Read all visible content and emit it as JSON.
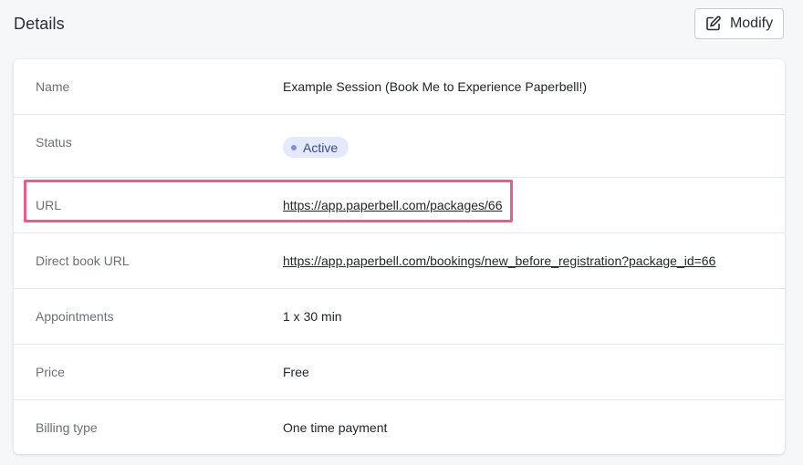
{
  "header": {
    "title": "Details",
    "modify_label": "Modify",
    "modify_icon": "edit-icon"
  },
  "details": {
    "rows": [
      {
        "label": "Name",
        "value": "Example Session (Book Me to Experience Paperbell!)"
      },
      {
        "label": "Status",
        "value": "Active"
      },
      {
        "label": "URL",
        "value": "https://app.paperbell.com/packages/66"
      },
      {
        "label": "Direct book URL",
        "value": "https://app.paperbell.com/bookings/new_before_registration?package_id=66"
      },
      {
        "label": "Appointments",
        "value": "1 x 30 min"
      },
      {
        "label": "Price",
        "value": "Free"
      },
      {
        "label": "Billing type",
        "value": "One time payment"
      }
    ]
  },
  "colors": {
    "highlight": "#ec5b8c",
    "status_badge_bg": "#e4e9fb",
    "status_dot": "#7e8fdc"
  }
}
